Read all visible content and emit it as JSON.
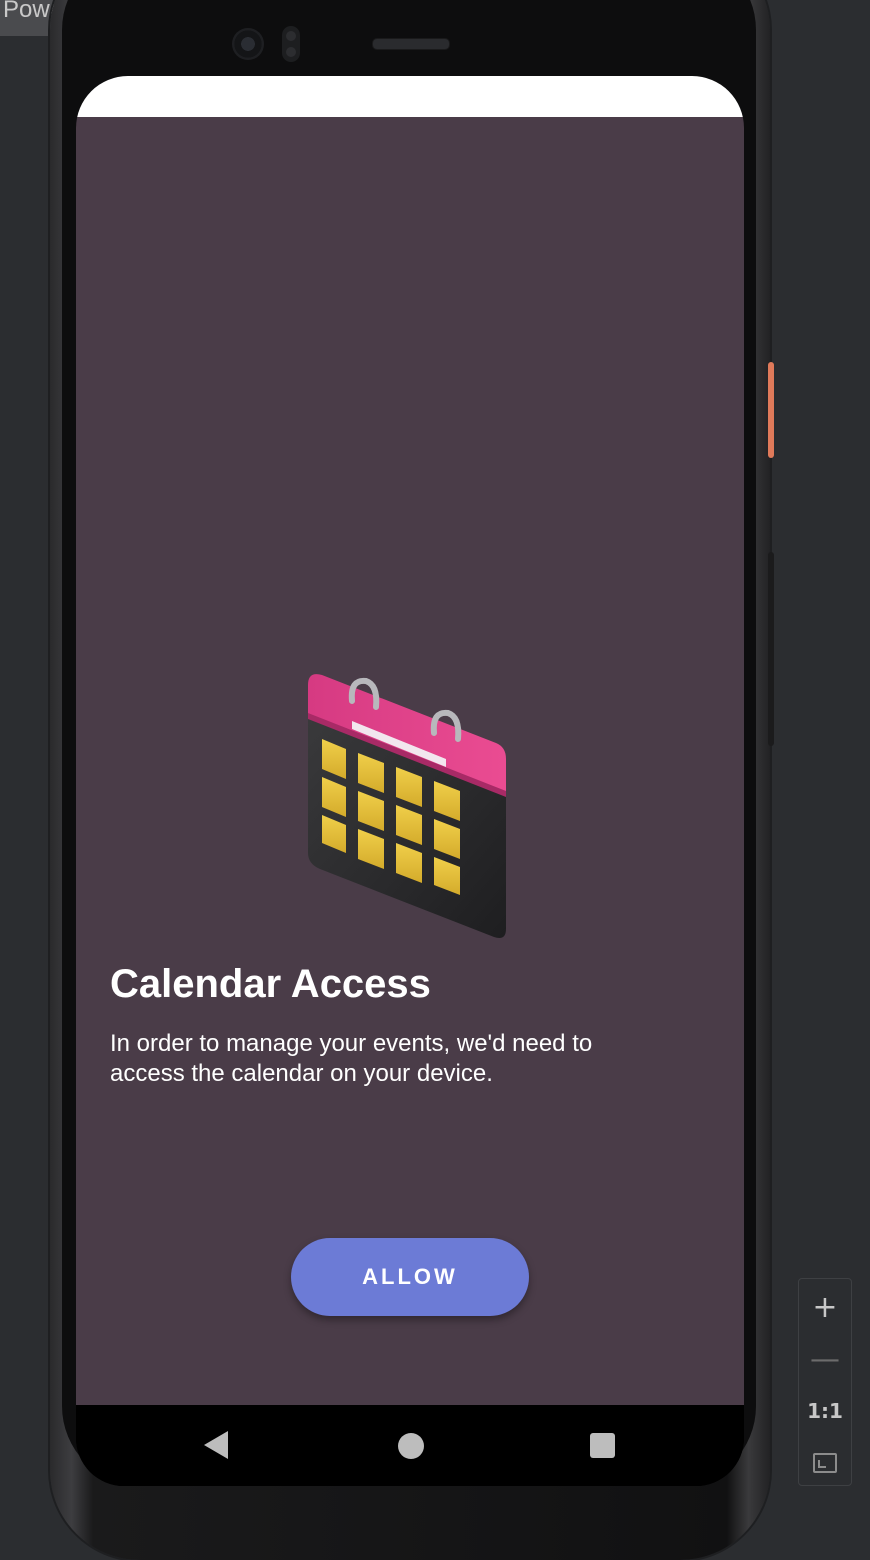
{
  "tooltip": {
    "label": "Power"
  },
  "screen": {
    "title": "Calendar Access",
    "description": "In order to manage your events, we'd need to access the calendar on your device.",
    "allow_button": "ALLOW",
    "illustration_icon": "calendar-icon"
  },
  "nav_bar": {
    "back_icon": "back-triangle-icon",
    "home_icon": "home-circle-icon",
    "recents_icon": "recents-square-icon"
  },
  "zoom_controls": {
    "zoom_in": "+",
    "zoom_out": "—",
    "actual_size": "1:1",
    "fit_icon": "fit-screen-icon"
  },
  "colors": {
    "app_background": "#4a3c48",
    "button": "#6c7bd6",
    "status_bar": "#ffffff",
    "nav_bar": "#000000",
    "side_button_accent": "#e07a5a",
    "calendar_top": "#e0468a",
    "calendar_cells": "#e6c23a"
  }
}
